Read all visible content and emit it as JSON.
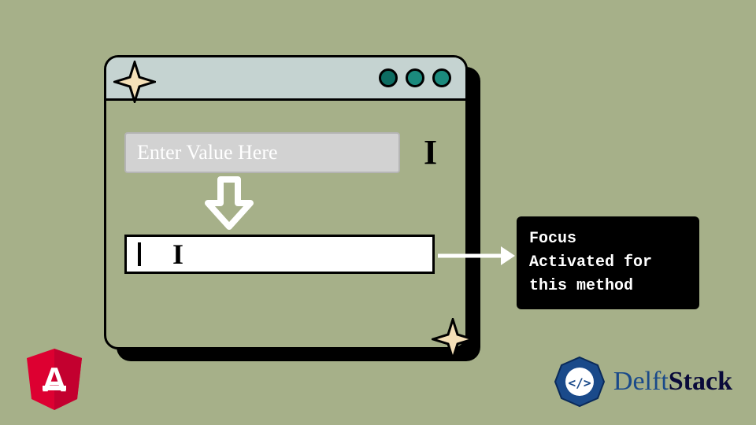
{
  "inputs": {
    "placeholder": "Enter Value Here"
  },
  "tooltip": {
    "line1": "Focus",
    "line2": "Activated for",
    "line3": "this method"
  },
  "logos": {
    "angular_letter": "A",
    "delft_prefix": "Delft",
    "delft_suffix": "Stack"
  },
  "colors": {
    "bg": "#a6b089",
    "titlebar": "#c5d3d1",
    "dot": "#1b8a7d",
    "angular": "#dd0031",
    "delft_blue": "#1a4a8a"
  }
}
